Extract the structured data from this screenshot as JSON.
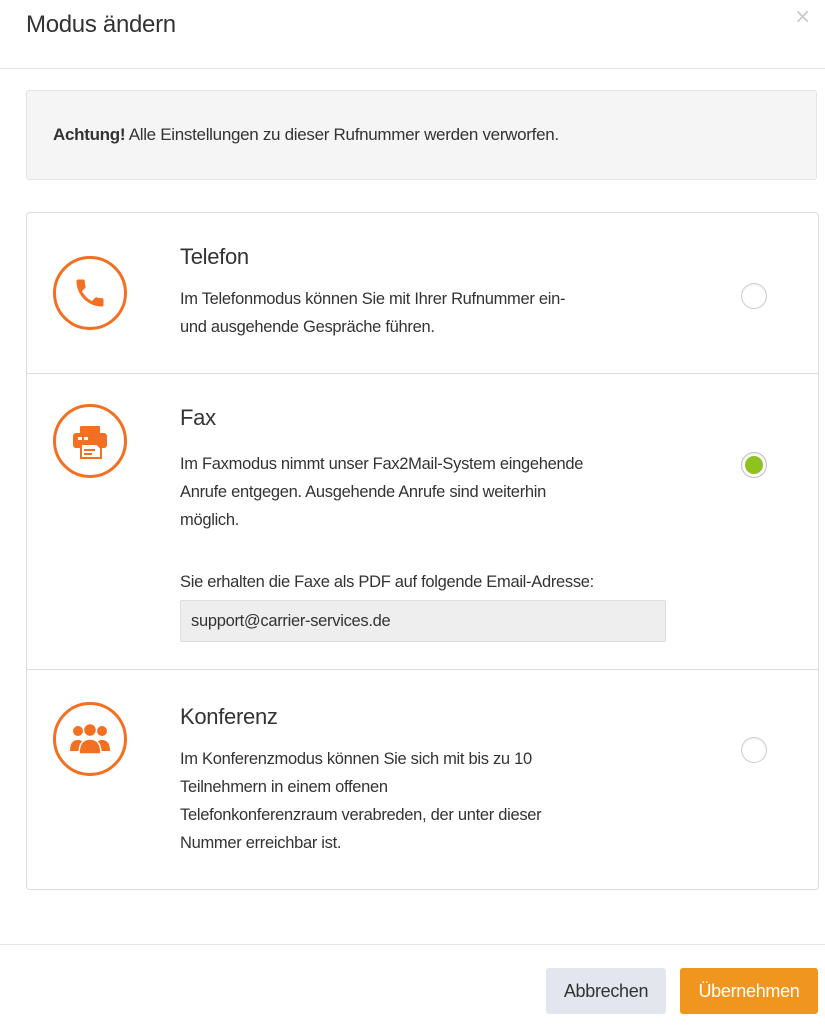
{
  "dialog": {
    "title": "Modus ändern",
    "close_glyph": "×"
  },
  "warning": {
    "strong": "Achtung!",
    "text": " Alle Einstellungen zu dieser Rufnummer werden verworfen."
  },
  "options": [
    {
      "title": "Telefon",
      "icon": "phone-icon",
      "description_lines": [
        "Im Telefonmodus können Sie mit Ihrer Rufnummer ein-",
        "und ausgehende Gespräche führen."
      ],
      "selected": false
    },
    {
      "title": "Fax",
      "icon": "fax-icon",
      "description_lines": [
        "Im Faxmodus nimmt unser Fax2Mail-System eingehende",
        "Anrufe entgegen. Ausgehende Anrufe sind weiterhin",
        "möglich."
      ],
      "email_label": "Sie erhalten die Faxe als PDF auf folgende Email-Adresse:",
      "email_value": "support@carrier-services.de",
      "selected": true
    },
    {
      "title": "Konferenz",
      "icon": "conference-icon",
      "description_lines": [
        "Im Konferenzmodus können Sie sich mit bis zu 10",
        "Teilnehmern in einem offenen",
        "Telefonkonferenzraum verabreden, der unter dieser",
        "Nummer erreichbar ist."
      ],
      "selected": false
    }
  ],
  "footer": {
    "cancel_label": "Abbrechen",
    "submit_label": "Übernehmen"
  },
  "colors": {
    "icon_accent": "#f36f21",
    "radio_selected": "#8dc21f",
    "submit_button": "#f0961e",
    "cancel_button": "#e3e6ee"
  }
}
